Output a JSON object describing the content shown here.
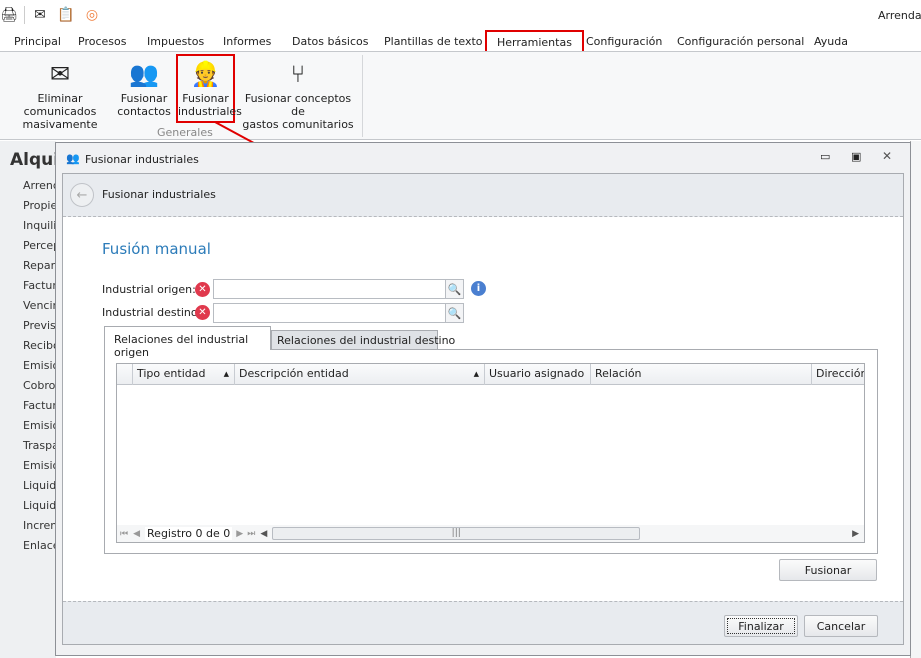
{
  "app": {
    "user_label": "Arrendad"
  },
  "ribbon": {
    "tabs": [
      "Principal",
      "Procesos",
      "Impuestos",
      "Informes",
      "Datos básicos",
      "Plantillas de texto",
      "Herramientas",
      "Configuración",
      "Configuración personal",
      "Ayuda"
    ],
    "buttons": [
      {
        "l1": "Eliminar comunicados",
        "l2": "masivamente"
      },
      {
        "l1": "Fusionar",
        "l2": "contactos"
      },
      {
        "l1": "Fusionar",
        "l2": "industriales"
      },
      {
        "l1": "Fusionar conceptos de",
        "l2": "gastos comunitarios"
      }
    ],
    "group_label": "Generales"
  },
  "sidebar": {
    "title": "Alquil",
    "items": [
      "Arrend",
      "Propiec",
      "Inquilin",
      "Percep",
      "Repart",
      "Factura",
      "Vencim",
      "Previsi",
      "Recibo",
      "Emision",
      "Cobros",
      "Factura",
      "Emision",
      "Traspa",
      "Emision",
      "Liquida",
      "Liquida",
      "Increm",
      "Enlaces"
    ]
  },
  "dialog": {
    "title": "Fusionar industriales",
    "header": "Fusionar industriales",
    "section_title": "Fusión manual",
    "origin_label": "Industrial origen:",
    "origin_value": "",
    "dest_label": "Industrial destino:",
    "dest_value": "",
    "tabs": [
      "Relaciones del industrial origen",
      "Relaciones del industrial destino"
    ],
    "columns": [
      "Tipo entidad",
      "Descripción entidad",
      "Usuario asignado",
      "Relación",
      "Dirección"
    ],
    "record_text": "Registro 0 de 0",
    "merge_button": "Fusionar",
    "finish_button": "Finalizar",
    "cancel_button": "Cancelar"
  },
  "colors": {
    "highlight": "#e00000",
    "section_title": "#2b7bb9"
  }
}
